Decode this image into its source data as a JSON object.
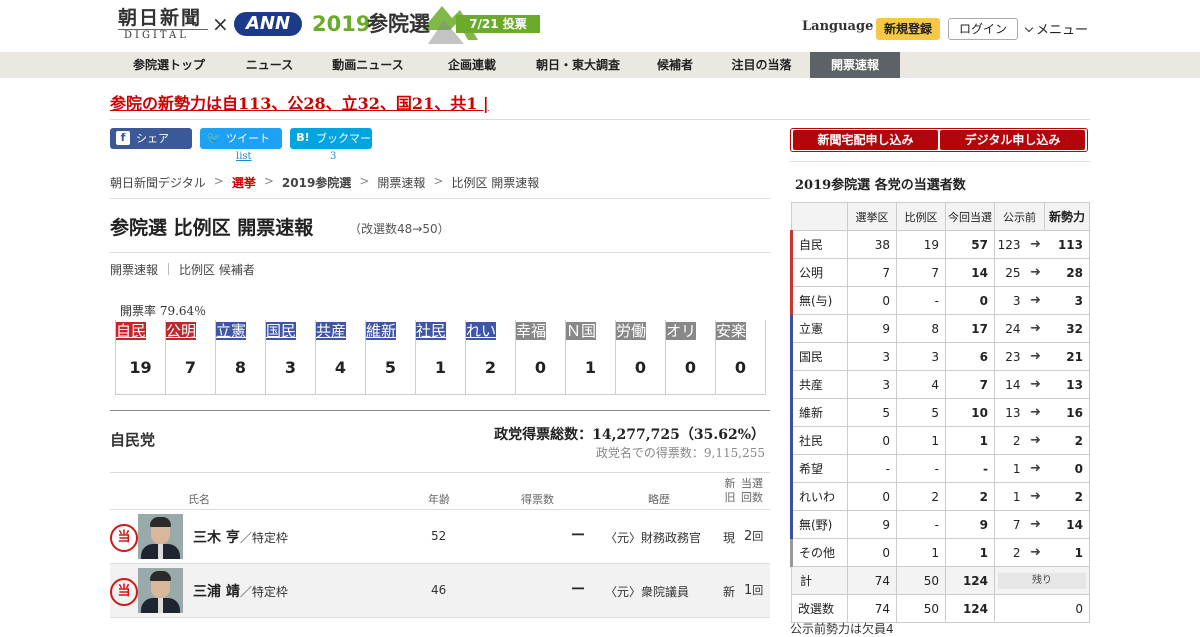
{
  "header": {
    "logo_main": "朝日新聞",
    "logo_sub": "DIGITAL",
    "logo_x": "×",
    "logo_ann": "ANN",
    "logo_year": "2019",
    "logo_election": "参院選",
    "logo_date": "7/21 投票",
    "language": "Language",
    "register": "新規登録",
    "login": "ログイン",
    "menu": "メニュー"
  },
  "nav": {
    "items": [
      {
        "label": "参院選トップ",
        "active": false
      },
      {
        "label": "ニュース",
        "active": false
      },
      {
        "label": "動画ニュース",
        "active": false
      },
      {
        "label": "企画連載",
        "active": false
      },
      {
        "label": "朝日・東大調査",
        "active": false
      },
      {
        "label": "候補者",
        "active": false
      },
      {
        "label": "注目の当落",
        "active": false
      },
      {
        "label": "開票速報",
        "active": true
      }
    ]
  },
  "headline": "参院の新勢力は自113、公28、立32、国21、共1 |",
  "share": {
    "facebook": "シェア",
    "twitter": "ツイート",
    "twitter_count": "list",
    "hatena": "ブックマーク",
    "hatena_count": "3"
  },
  "breadcrumb": {
    "items": [
      "朝日新聞デジタル",
      "選挙",
      "2019参院選",
      "開票速報",
      "比例区 開票速報"
    ],
    "sep": ">"
  },
  "page": {
    "title": "参院選 比例区 開票速報",
    "subtitle": "（改選数48→50）",
    "subnav": [
      "開票速報",
      "比例区 候補者"
    ]
  },
  "tally": {
    "rate": "開票率 79.64％",
    "parties": [
      {
        "name": "自民",
        "seats": "19",
        "color": "#c1262b"
      },
      {
        "name": "公明",
        "seats": "7",
        "color": "#c1262b"
      },
      {
        "name": "立憲",
        "seats": "8",
        "color": "#3e55a8"
      },
      {
        "name": "国民",
        "seats": "3",
        "color": "#3e55a8"
      },
      {
        "name": "共産",
        "seats": "4",
        "color": "#3e55a8"
      },
      {
        "name": "維新",
        "seats": "5",
        "color": "#3e55a8"
      },
      {
        "name": "社民",
        "seats": "1",
        "color": "#3e55a8"
      },
      {
        "name": "れい",
        "seats": "2",
        "color": "#3e55a8"
      },
      {
        "name": "幸福",
        "seats": "0",
        "color": "#888888"
      },
      {
        "name": "Ｎ国",
        "seats": "1",
        "color": "#888888"
      },
      {
        "name": "労働",
        "seats": "0",
        "color": "#888888"
      },
      {
        "name": "オリ",
        "seats": "0",
        "color": "#888888"
      },
      {
        "name": "安楽",
        "seats": "0",
        "color": "#888888"
      }
    ]
  },
  "party_section": {
    "name": "自民党",
    "total": "政党得票総数：14,277,725（35.62%）",
    "name_votes": "政党名での得票数：9,115,255",
    "headers": {
      "name": "氏名",
      "age": "年齢",
      "votes": "得票数",
      "career": "略歴",
      "status": "新旧",
      "count": "当選回数"
    },
    "candidates": [
      {
        "badge": "当",
        "name": "三木 亨",
        "frame": "／特定枠",
        "age": "52",
        "votes": "ー",
        "career": "〈元〉財務政務官",
        "status": "現",
        "count": "2",
        "unit": "回"
      },
      {
        "badge": "当",
        "name": "三浦 靖",
        "frame": "／特定枠",
        "age": "46",
        "votes": "ー",
        "career": "〈元〉衆院議員",
        "status": "新",
        "count": "1",
        "unit": "回"
      }
    ]
  },
  "sidebar": {
    "subscribe_paper": "新聞宅配申し込み",
    "subscribe_digital": "デジタル申し込み",
    "title": "2019参院選 各党の当選者数",
    "columns": [
      "",
      "選挙区",
      "比例区",
      "今回当選",
      "公示前",
      "新勢力"
    ],
    "arrow": "➜",
    "rows": [
      {
        "party": "自民",
        "group": "gov",
        "district": "38",
        "pr": "19",
        "won": "57",
        "before": "123",
        "after": "113"
      },
      {
        "party": "公明",
        "group": "gov",
        "district": "7",
        "pr": "7",
        "won": "14",
        "before": "25",
        "after": "28"
      },
      {
        "party": "無(与)",
        "group": "gov",
        "district": "0",
        "pr": "-",
        "won": "0",
        "before": "3",
        "after": "3"
      },
      {
        "party": "立憲",
        "group": "opp",
        "district": "9",
        "pr": "8",
        "won": "17",
        "before": "24",
        "after": "32"
      },
      {
        "party": "国民",
        "group": "opp",
        "district": "3",
        "pr": "3",
        "won": "6",
        "before": "23",
        "after": "21"
      },
      {
        "party": "共産",
        "group": "opp",
        "district": "3",
        "pr": "4",
        "won": "7",
        "before": "14",
        "after": "13"
      },
      {
        "party": "維新",
        "group": "opp",
        "district": "5",
        "pr": "5",
        "won": "10",
        "before": "13",
        "after": "16"
      },
      {
        "party": "社民",
        "group": "opp",
        "district": "0",
        "pr": "1",
        "won": "1",
        "before": "2",
        "after": "2"
      },
      {
        "party": "希望",
        "group": "opp",
        "district": "-",
        "pr": "-",
        "won": "-",
        "before": "1",
        "after": "0"
      },
      {
        "party": "れいわ",
        "group": "opp",
        "district": "0",
        "pr": "2",
        "won": "2",
        "before": "1",
        "after": "2"
      },
      {
        "party": "無(野)",
        "group": "opp",
        "district": "9",
        "pr": "-",
        "won": "9",
        "before": "7",
        "after": "14"
      },
      {
        "party": "その他",
        "group": "oth",
        "district": "0",
        "pr": "1",
        "won": "1",
        "before": "2",
        "after": "1"
      }
    ],
    "total_row": {
      "label": "計",
      "district": "74",
      "pr": "50",
      "won": "124",
      "remain": "残り"
    },
    "seats_row": {
      "label": "改選数",
      "district": "74",
      "pr": "50",
      "won": "124",
      "remain": "0"
    },
    "footnote": "公示前勢力は欠員4"
  }
}
